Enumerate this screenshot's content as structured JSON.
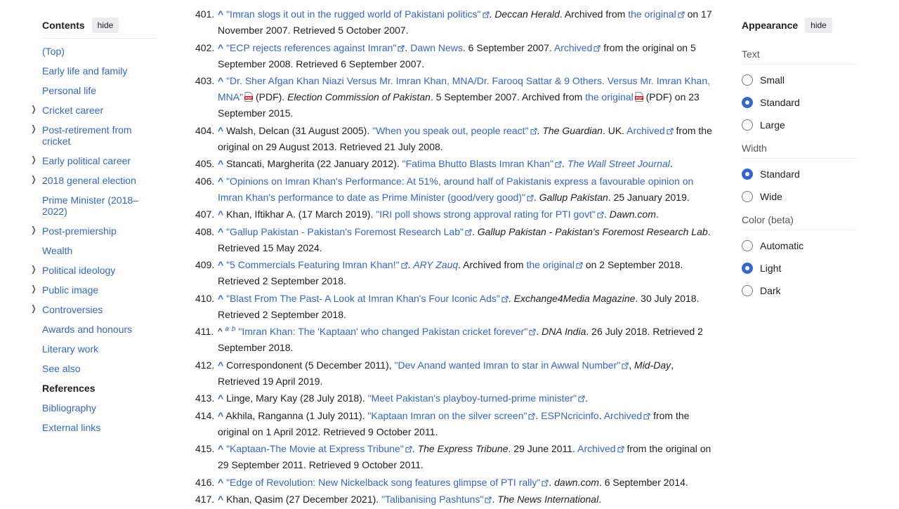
{
  "toc": {
    "title": "Contents",
    "hide": "hide",
    "items": [
      {
        "label": "(Top)",
        "expand": false
      },
      {
        "label": "Early life and family",
        "expand": false
      },
      {
        "label": "Personal life",
        "expand": false
      },
      {
        "label": "Cricket career",
        "expand": true
      },
      {
        "label": "Post-retirement from cricket",
        "expand": true
      },
      {
        "label": "Early political career",
        "expand": true
      },
      {
        "label": "2018 general election",
        "expand": true
      },
      {
        "label": "Prime Minister (2018–2022)",
        "expand": false
      },
      {
        "label": "Post-premiership",
        "expand": true
      },
      {
        "label": "Wealth",
        "expand": false
      },
      {
        "label": "Political ideology",
        "expand": true
      },
      {
        "label": "Public image",
        "expand": true
      },
      {
        "label": "Controversies",
        "expand": true
      },
      {
        "label": "Awards and honours",
        "expand": false
      },
      {
        "label": "Literary work",
        "expand": false
      },
      {
        "label": "See also",
        "expand": false
      },
      {
        "label": "References",
        "expand": false,
        "active": true
      },
      {
        "label": "Bibliography",
        "expand": false
      },
      {
        "label": "External links",
        "expand": false
      }
    ]
  },
  "references": [
    {
      "num": "401.",
      "parts": [
        {
          "t": "caret",
          "v": "^"
        },
        {
          "t": "text",
          "v": " "
        },
        {
          "t": "link",
          "v": "\"Imran slogs it out in the rugged world of Pakistani politics\"",
          "ext": true
        },
        {
          "t": "text",
          "v": ". "
        },
        {
          "t": "italic",
          "v": "Deccan Herald"
        },
        {
          "t": "text",
          "v": ". Archived from "
        },
        {
          "t": "link",
          "v": "the original",
          "ext": true
        },
        {
          "t": "text",
          "v": " on 17 November 2007. Retrieved 5 October 2007."
        }
      ]
    },
    {
      "num": "402.",
      "parts": [
        {
          "t": "caret",
          "v": "^"
        },
        {
          "t": "text",
          "v": " "
        },
        {
          "t": "link",
          "v": "\"ECP rejects references against Imran\"",
          "ext": true
        },
        {
          "t": "text",
          "v": ". "
        },
        {
          "t": "link",
          "v": "Dawn News"
        },
        {
          "t": "text",
          "v": ". 6 September 2007. "
        },
        {
          "t": "link",
          "v": "Archived",
          "ext": true
        },
        {
          "t": "text",
          "v": " from the original on 5 September 2008. Retrieved 6 September 2007."
        }
      ]
    },
    {
      "num": "403.",
      "parts": [
        {
          "t": "caret",
          "v": "^"
        },
        {
          "t": "text",
          "v": " "
        },
        {
          "t": "link",
          "v": "\"Dr. Sher Afgan Khan Niazi Versus Mr. Imran Khan, MNA/Dr. Farooq Sattar & 9 Others. Versus Mr. Imran Khan, MNA\"",
          "pdf": true
        },
        {
          "t": "text",
          "v": " (PDF). "
        },
        {
          "t": "italic",
          "v": "Election Commission of Pakistan"
        },
        {
          "t": "text",
          "v": ". 5 September 2007. Archived from "
        },
        {
          "t": "link",
          "v": "the original",
          "pdf": true
        },
        {
          "t": "text",
          "v": " (PDF) on 23 September 2015."
        }
      ]
    },
    {
      "num": "404.",
      "parts": [
        {
          "t": "caret",
          "v": "^"
        },
        {
          "t": "text",
          "v": " Walsh, Delcan (31 August 2005). "
        },
        {
          "t": "link",
          "v": "\"When you speak out, people react\"",
          "ext": true
        },
        {
          "t": "text",
          "v": ". "
        },
        {
          "t": "italic",
          "v": "The Guardian"
        },
        {
          "t": "text",
          "v": ". UK. "
        },
        {
          "t": "link",
          "v": "Archived",
          "ext": true
        },
        {
          "t": "text",
          "v": " from the original on 29 August 2013. Retrieved 21 July 2008."
        }
      ]
    },
    {
      "num": "405.",
      "parts": [
        {
          "t": "caret",
          "v": "^"
        },
        {
          "t": "text",
          "v": " Stancati, Margherita (22 January 2012). "
        },
        {
          "t": "link",
          "v": "\"Fatima Bhutto Blasts Imran Khan\"",
          "ext": true
        },
        {
          "t": "text",
          "v": ". "
        },
        {
          "t": "italiclink",
          "v": "The Wall Street Journal"
        },
        {
          "t": "text",
          "v": "."
        }
      ]
    },
    {
      "num": "406.",
      "parts": [
        {
          "t": "caret",
          "v": "^"
        },
        {
          "t": "text",
          "v": " "
        },
        {
          "t": "link",
          "v": "\"Opinions on Imran Khan's Performance: At 51%, around half of Pakistanis express a favourable opinion on Imran Khan's performance to date as Prime Minister (good/very good)\"",
          "ext": true
        },
        {
          "t": "text",
          "v": ". "
        },
        {
          "t": "italic",
          "v": "Gallup Pakistan"
        },
        {
          "t": "text",
          "v": ". 25 January 2019."
        }
      ]
    },
    {
      "num": "407.",
      "parts": [
        {
          "t": "caret",
          "v": "^"
        },
        {
          "t": "text",
          "v": " Khan, Iftikhar A. (17 March 2019). "
        },
        {
          "t": "link",
          "v": "\"IRI poll shows strong approval rating for PTI govt\"",
          "ext": true
        },
        {
          "t": "text",
          "v": ". "
        },
        {
          "t": "italic",
          "v": "Dawn.com"
        },
        {
          "t": "text",
          "v": "."
        }
      ]
    },
    {
      "num": "408.",
      "parts": [
        {
          "t": "caret",
          "v": "^"
        },
        {
          "t": "text",
          "v": " "
        },
        {
          "t": "link",
          "v": "\"Gallup Pakistan - Pakistan's Foremost Research Lab\"",
          "ext": true
        },
        {
          "t": "text",
          "v": ". "
        },
        {
          "t": "italic",
          "v": "Gallup Pakistan - Pakistan's Foremost Research Lab"
        },
        {
          "t": "text",
          "v": ". Retrieved 15 May 2024."
        }
      ]
    },
    {
      "num": "409.",
      "parts": [
        {
          "t": "caret",
          "v": "^"
        },
        {
          "t": "text",
          "v": " "
        },
        {
          "t": "link",
          "v": "\"5 Commercials Featuring Imran Khan!\"",
          "ext": true
        },
        {
          "t": "text",
          "v": ". "
        },
        {
          "t": "italiclink",
          "v": "ARY Zauq"
        },
        {
          "t": "text",
          "v": ". Archived from "
        },
        {
          "t": "link",
          "v": "the original",
          "ext": true
        },
        {
          "t": "text",
          "v": " on 2 September 2018. Retrieved 2 September 2018."
        }
      ]
    },
    {
      "num": "410.",
      "parts": [
        {
          "t": "caret",
          "v": "^"
        },
        {
          "t": "text",
          "v": " "
        },
        {
          "t": "link",
          "v": "\"Blast From The Past- A Look at Imran Khan's Four Iconic Ads\"",
          "ext": true
        },
        {
          "t": "text",
          "v": ". "
        },
        {
          "t": "italic",
          "v": "Exchange4Media Magazine"
        },
        {
          "t": "text",
          "v": ". 30 July 2018. Retrieved 2 September 2018."
        }
      ]
    },
    {
      "num": "411.",
      "parts": [
        {
          "t": "plain",
          "v": "^"
        },
        {
          "t": "text",
          "v": " "
        },
        {
          "t": "sup",
          "v": "a"
        },
        {
          "t": "text",
          "v": " "
        },
        {
          "t": "sup",
          "v": "b"
        },
        {
          "t": "text",
          "v": " "
        },
        {
          "t": "link",
          "v": "\"Imran Khan: The 'Kaptaan' who changed Pakistan cricket forever\"",
          "ext": true
        },
        {
          "t": "text",
          "v": ". "
        },
        {
          "t": "italic",
          "v": "DNA India"
        },
        {
          "t": "text",
          "v": ". 26 July 2018. Retrieved 2 September 2018."
        }
      ]
    },
    {
      "num": "412.",
      "parts": [
        {
          "t": "caret",
          "v": "^"
        },
        {
          "t": "text",
          "v": " Correspondonent (5 December 2011), "
        },
        {
          "t": "link",
          "v": "\"Dev Anand wanted Imran to star in Awwal Number\"",
          "ext": true
        },
        {
          "t": "text",
          "v": ", "
        },
        {
          "t": "italic",
          "v": "Mid-Day"
        },
        {
          "t": "text",
          "v": ", Retrieved 19 April 2019."
        }
      ]
    },
    {
      "num": "413.",
      "parts": [
        {
          "t": "caret",
          "v": "^"
        },
        {
          "t": "text",
          "v": " Linge, Mary Kay (28 July 2018). "
        },
        {
          "t": "link",
          "v": "\"Meet Pakistan's playboy-turned-prime minister\"",
          "ext": true
        },
        {
          "t": "text",
          "v": "."
        }
      ]
    },
    {
      "num": "414.",
      "parts": [
        {
          "t": "caret",
          "v": "^"
        },
        {
          "t": "text",
          "v": " Akhila, Ranganna (1 July 2011). "
        },
        {
          "t": "link",
          "v": "\"Kaptaan Imran on the silver screen\"",
          "ext": true
        },
        {
          "t": "text",
          "v": ". "
        },
        {
          "t": "link",
          "v": "ESPNcricinfo"
        },
        {
          "t": "text",
          "v": ". "
        },
        {
          "t": "link",
          "v": "Archived",
          "ext": true
        },
        {
          "t": "text",
          "v": " from the original on 1 April 2012. Retrieved 9 October 2011."
        }
      ]
    },
    {
      "num": "415.",
      "parts": [
        {
          "t": "caret",
          "v": "^"
        },
        {
          "t": "text",
          "v": " "
        },
        {
          "t": "link",
          "v": "\"Kaptaan-The Movie at Express Tribune\"",
          "ext": true
        },
        {
          "t": "text",
          "v": ". "
        },
        {
          "t": "italic",
          "v": "The Express Tribune"
        },
        {
          "t": "text",
          "v": ". 29 June 2011. "
        },
        {
          "t": "link",
          "v": "Archived",
          "ext": true
        },
        {
          "t": "text",
          "v": " from the original on 29 September 2011. Retrieved 9 October 2011."
        }
      ]
    },
    {
      "num": "416.",
      "parts": [
        {
          "t": "caret",
          "v": "^"
        },
        {
          "t": "text",
          "v": " "
        },
        {
          "t": "link",
          "v": "\"Edge of Revolution: New Nickelback song features glimpse of PTI rally\"",
          "ext": true
        },
        {
          "t": "text",
          "v": ". "
        },
        {
          "t": "italic",
          "v": "dawn.com"
        },
        {
          "t": "text",
          "v": ". 6 September 2014."
        }
      ]
    },
    {
      "num": "417.",
      "parts": [
        {
          "t": "caret",
          "v": "^"
        },
        {
          "t": "text",
          "v": " Khan, Qasim (27 December 2021). "
        },
        {
          "t": "link",
          "v": "\"Talibanising Pashtuns\"",
          "ext": true
        },
        {
          "t": "text",
          "v": ". "
        },
        {
          "t": "italic",
          "v": "The News International"
        },
        {
          "t": "text",
          "v": "."
        }
      ]
    }
  ],
  "appearance": {
    "title": "Appearance",
    "hide": "hide",
    "groups": [
      {
        "label": "Text",
        "options": [
          {
            "label": "Small",
            "selected": false
          },
          {
            "label": "Standard",
            "selected": true
          },
          {
            "label": "Large",
            "selected": false
          }
        ]
      },
      {
        "label": "Width",
        "options": [
          {
            "label": "Standard",
            "selected": true
          },
          {
            "label": "Wide",
            "selected": false
          }
        ]
      },
      {
        "label": "Color (beta)",
        "options": [
          {
            "label": "Automatic",
            "selected": false
          },
          {
            "label": "Light",
            "selected": true
          },
          {
            "label": "Dark",
            "selected": false
          }
        ]
      }
    ]
  }
}
